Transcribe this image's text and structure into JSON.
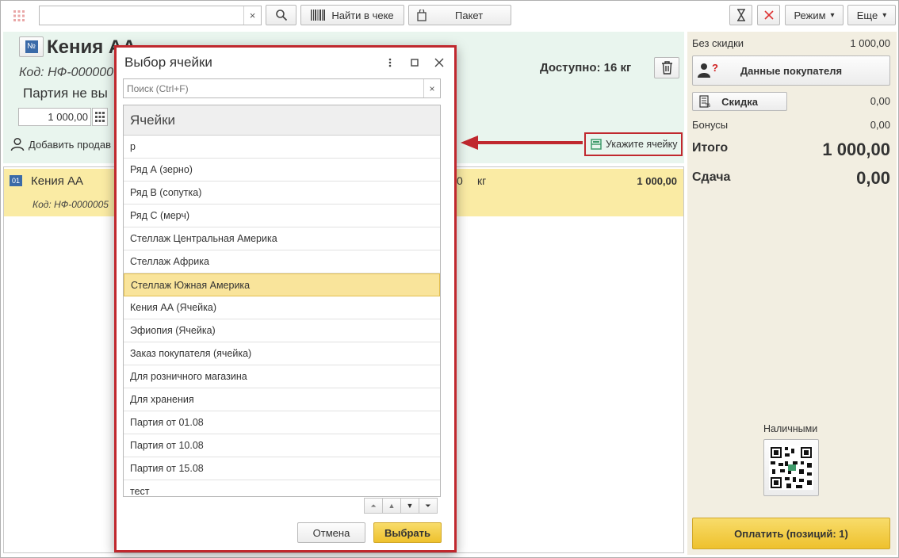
{
  "toolbar": {
    "search_value": "",
    "search_clear": "×",
    "find_in_receipt": "Найти в чеке",
    "package": "Пакет",
    "mode": "Режим",
    "more": "Еще",
    "dropdown_arrow": "▾"
  },
  "product": {
    "name": "Кения АА",
    "code": "Код: НФ-000000",
    "batch": "Партия не вы",
    "price_value": "1 000,00",
    "available": "Доступно: 16 кг",
    "add_seller": "Добавить продав",
    "specify_cell": "Укажите ячейку"
  },
  "line": {
    "index": "01",
    "name": "Кения АА",
    "code": "Код: НФ-0000005",
    "qty": "0",
    "unit": "кг",
    "sum": "1 000,00"
  },
  "summary": {
    "without_discount_label": "Без скидки",
    "without_discount_value": "1 000,00",
    "customer_data": "Данные покупателя",
    "discount_button": "Скидка",
    "discount_value": "0,00",
    "bonus_label": "Бонусы",
    "bonus_value": "0,00",
    "total_label": "Итого",
    "total_value": "1 000,00",
    "change_label": "Сдача",
    "change_value": "0,00",
    "cash_label": "Наличными",
    "pay_button": "Оплатить (позиций: 1)"
  },
  "dialog": {
    "title": "Выбор ячейки",
    "search_placeholder": "Поиск (Ctrl+F)",
    "search_clear": "×",
    "column_header": "Ячейки",
    "rows": [
      "р",
      "Ряд А (зерно)",
      "Ряд В (сопутка)",
      "Ряд С (мерч)",
      "Стеллаж Центральная Америка",
      "Стеллаж Африка",
      "Стеллаж Южная Америка",
      "Кения АА (Ячейка)",
      "Эфиопия (Ячейка)",
      "Заказ покупателя (ячейка)",
      "Для розничного магазина",
      "Для хранения",
      "Партия от 01.08",
      "Партия от 10.08",
      "Партия от 15.08",
      "тест"
    ],
    "selected_index": 6,
    "cancel": "Отмена",
    "select": "Выбрать"
  },
  "colors": {
    "highlight_red": "#c0282e",
    "selection_yellow": "#f9e49b",
    "pay_button": "#f2cd3c",
    "product_panel": "#e9f5ee",
    "summary_panel": "#f2eee1"
  }
}
